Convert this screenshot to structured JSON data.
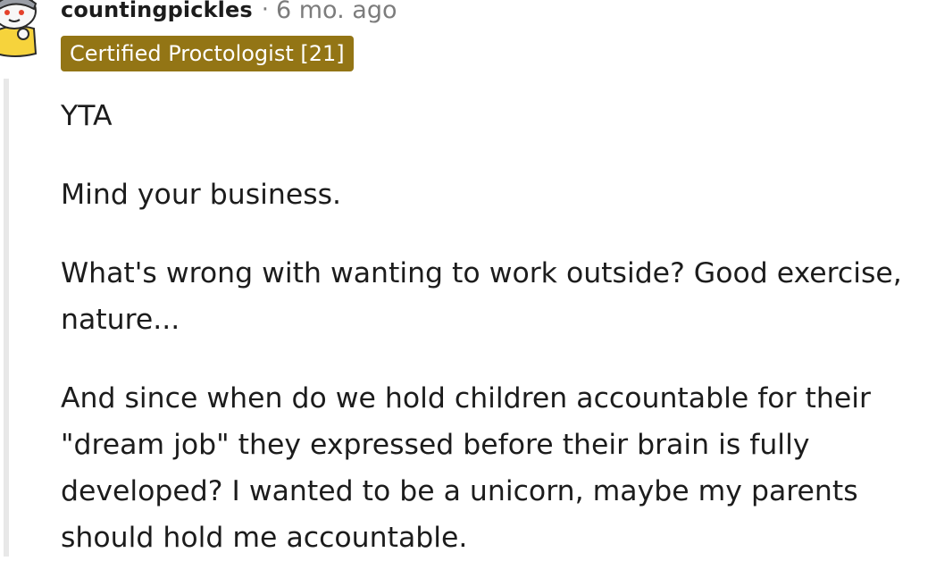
{
  "comment": {
    "username": "countingpickles",
    "separator": "·",
    "timestamp": "6 mo. ago",
    "flair": "Certified Proctologist [21]",
    "paragraphs": [
      "YTA",
      "Mind your business.",
      "What's wrong with wanting to work outside? Good exercise, nature...",
      "And since when do we hold children accountable for their \"dream job\" they expressed before their brain is fully developed? I wanted to be a unicorn, maybe my parents should hold me accountable."
    ]
  },
  "avatar": {
    "icon": "snoo-avatar-icon"
  },
  "colors": {
    "flair_background": "#937515",
    "flair_text": "#ffffff",
    "meta_text": "#7c7c7c",
    "body_text": "#1c1c1c",
    "thread_line": "#e8e8e8"
  }
}
